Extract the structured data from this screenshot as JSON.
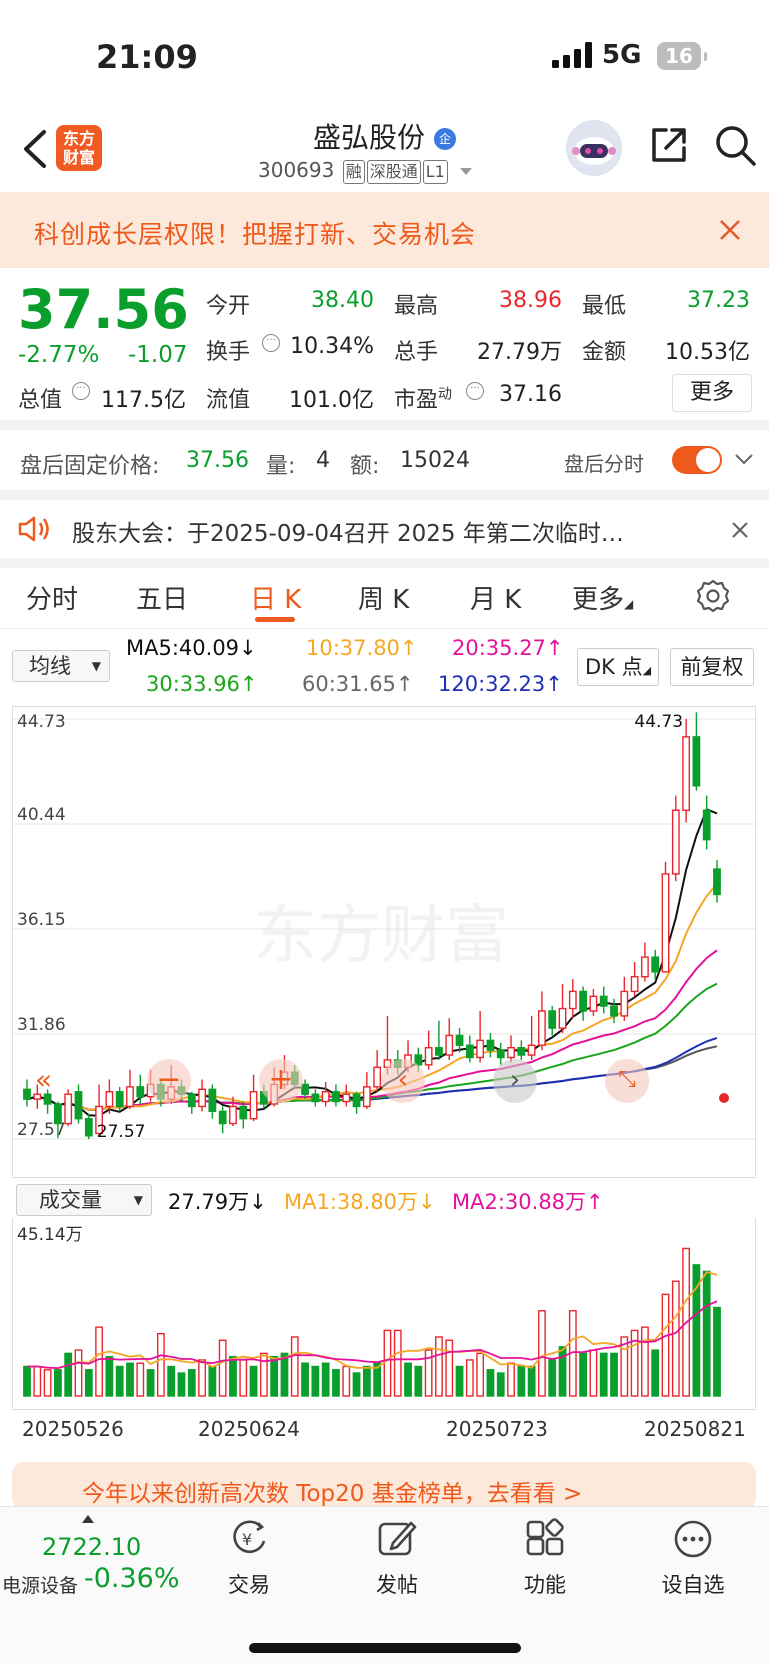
{
  "status_bar": {
    "time": "21:09",
    "network": "5G",
    "battery": "16"
  },
  "header": {
    "logo_line1": "东方",
    "logo_line2": "财富",
    "stock_name": "盛弘股份",
    "badge": "企",
    "code": "300693",
    "tags": [
      "融",
      "深股通",
      "L1"
    ]
  },
  "banner": {
    "text": "科创成长层权限！把握打新、交易机会"
  },
  "quote": {
    "price": "37.56",
    "change_pct": "-2.77%",
    "change": "-1.07",
    "open_label": "今开",
    "open": "38.40",
    "high_label": "最高",
    "high": "38.96",
    "low_label": "最低",
    "low": "37.23",
    "turnover_label": "换手",
    "turnover": "10.34%",
    "volume_label": "总手",
    "volume": "27.79万",
    "amount_label": "金额",
    "amount": "10.53亿",
    "mcap_label": "总值",
    "mcap": "117.5亿",
    "float_label": "流值",
    "float": "101.0亿",
    "pe_label": "市盈",
    "pe_sup": "动",
    "pe": "37.16",
    "more_label": "更多"
  },
  "after_hours": {
    "label": "盘后固定价格:",
    "price": "37.56",
    "vol_label": "量:",
    "vol": "4",
    "amt_label": "额:",
    "amt": "15024",
    "toggle_label": "盘后分时"
  },
  "notice": {
    "text": "股东大会：于2025-09-04召开 2025 年第二次临时…"
  },
  "tabs": [
    {
      "label": "分时"
    },
    {
      "label": "五日"
    },
    {
      "label": "日 K"
    },
    {
      "label": "周 K"
    },
    {
      "label": "月 K"
    },
    {
      "label": "更多"
    }
  ],
  "ma_bar": {
    "selector": "均线",
    "ma5": "MA5:40.09↓",
    "ma10": "10:37.80↑",
    "ma20": "20:35.27↑",
    "ma30": "30:33.96↑",
    "ma60": "60:31.65↑",
    "ma120": "120:32.23↑",
    "dk_label": "DK 点",
    "adjust_label": "前复权"
  },
  "chart_data": {
    "type": "candlestick",
    "y_ticks": [
      "44.73",
      "40.44",
      "36.15",
      "31.86",
      "27.57"
    ],
    "ylim": [
      27.57,
      44.73
    ],
    "max_label": "44.73",
    "min_label": "27.57",
    "watermark": "东方财富",
    "x_labels": [
      "20250526",
      "20250624",
      "20250723",
      "20250821"
    ],
    "candles": [
      [
        29.6,
        29.2,
        30.0,
        28.9
      ],
      [
        29.2,
        29.4,
        29.8,
        28.8
      ],
      [
        29.4,
        29.0,
        29.6,
        28.6
      ],
      [
        29.0,
        28.2,
        29.1,
        27.6
      ],
      [
        28.2,
        29.4,
        29.6,
        28.1
      ],
      [
        29.5,
        28.4,
        29.8,
        28.2
      ],
      [
        28.4,
        27.7,
        28.6,
        27.57
      ],
      [
        27.8,
        28.9,
        29.8,
        27.7
      ],
      [
        28.9,
        29.5,
        30.0,
        28.6
      ],
      [
        29.5,
        28.9,
        29.7,
        28.7
      ],
      [
        28.9,
        29.7,
        30.4,
        28.8
      ],
      [
        29.7,
        29.3,
        30.2,
        29.0
      ],
      [
        29.3,
        29.8,
        30.4,
        29.1
      ],
      [
        29.8,
        29.2,
        30.0,
        28.9
      ],
      [
        29.2,
        29.7,
        30.6,
        29.0
      ],
      [
        29.7,
        29.4,
        30.0,
        29.1
      ],
      [
        29.4,
        28.9,
        29.5,
        28.6
      ],
      [
        28.9,
        29.6,
        30.0,
        28.7
      ],
      [
        29.6,
        28.7,
        29.8,
        28.4
      ],
      [
        28.7,
        28.2,
        28.9,
        27.8
      ],
      [
        28.2,
        28.9,
        29.3,
        28.1
      ],
      [
        28.9,
        28.4,
        29.1,
        28.0
      ],
      [
        28.4,
        29.5,
        30.2,
        28.3
      ],
      [
        29.5,
        29.0,
        29.8,
        28.8
      ],
      [
        29.0,
        29.8,
        30.5,
        28.9
      ],
      [
        29.8,
        30.3,
        31.0,
        29.6
      ],
      [
        30.3,
        29.8,
        30.6,
        29.6
      ],
      [
        29.8,
        29.4,
        30.0,
        29.2
      ],
      [
        29.4,
        29.1,
        29.6,
        28.9
      ],
      [
        29.1,
        29.5,
        29.9,
        28.9
      ],
      [
        29.5,
        29.1,
        29.8,
        28.9
      ],
      [
        29.1,
        29.4,
        29.8,
        28.9
      ],
      [
        29.4,
        28.9,
        29.5,
        28.6
      ],
      [
        28.9,
        29.7,
        30.3,
        28.8
      ],
      [
        29.7,
        30.5,
        31.2,
        29.5
      ],
      [
        30.5,
        30.8,
        32.6,
        30.2
      ],
      [
        30.8,
        30.5,
        31.2,
        30.2
      ],
      [
        30.5,
        31.0,
        31.6,
        30.3
      ],
      [
        31.0,
        30.6,
        31.3,
        30.3
      ],
      [
        30.6,
        31.3,
        32.0,
        30.4
      ],
      [
        31.3,
        31.0,
        32.4,
        30.8
      ],
      [
        31.0,
        31.8,
        32.5,
        30.8
      ],
      [
        31.8,
        31.4,
        32.1,
        31.1
      ],
      [
        31.4,
        30.9,
        31.8,
        30.7
      ],
      [
        30.9,
        31.6,
        32.8,
        30.7
      ],
      [
        31.6,
        31.2,
        31.9,
        30.9
      ],
      [
        31.2,
        30.9,
        31.5,
        30.6
      ],
      [
        30.9,
        31.3,
        31.8,
        30.7
      ],
      [
        31.3,
        31.0,
        31.6,
        30.8
      ],
      [
        31.0,
        31.4,
        32.6,
        30.8
      ],
      [
        31.4,
        32.8,
        33.6,
        31.2
      ],
      [
        32.8,
        32.1,
        33.0,
        31.8
      ],
      [
        32.1,
        32.9,
        33.9,
        31.9
      ],
      [
        32.9,
        33.6,
        34.1,
        32.5
      ],
      [
        33.6,
        32.8,
        33.8,
        32.4
      ],
      [
        32.8,
        33.4,
        33.7,
        32.6
      ],
      [
        33.4,
        33.0,
        33.8,
        32.7
      ],
      [
        33.0,
        32.6,
        33.3,
        32.3
      ],
      [
        32.6,
        33.6,
        34.2,
        32.4
      ],
      [
        33.6,
        34.2,
        34.8,
        33.4
      ],
      [
        34.2,
        35.0,
        35.6,
        34.0
      ],
      [
        35.0,
        34.4,
        35.3,
        34.1
      ],
      [
        34.4,
        38.4,
        38.9,
        34.4
      ],
      [
        38.4,
        41.0,
        41.6,
        38.1
      ],
      [
        41.0,
        44.0,
        44.73,
        40.5
      ],
      [
        44.0,
        42.0,
        45.0,
        41.8
      ],
      [
        41.0,
        39.8,
        41.6,
        39.4
      ],
      [
        38.6,
        37.56,
        38.96,
        37.23
      ]
    ],
    "volume": {
      "label": "成交量",
      "value": "27.79万↓",
      "ma1": "MA1:38.80万↓",
      "ma2": "MA2:30.88万↑",
      "max_label": "45.14万",
      "values": [
        9,
        9,
        8,
        8,
        13,
        14,
        8,
        21,
        12,
        9,
        10,
        10,
        8,
        19,
        9,
        7,
        8,
        11,
        9,
        17,
        12,
        11,
        9,
        13,
        12,
        13,
        18,
        10,
        9,
        10,
        8,
        9,
        7,
        9,
        10,
        20,
        20,
        10,
        9,
        14,
        18,
        17,
        9,
        11,
        13,
        8,
        7,
        10,
        9,
        9,
        26,
        11,
        15,
        26,
        13,
        14,
        13,
        13,
        18,
        20,
        21,
        14,
        31,
        35,
        45,
        40,
        38,
        27
      ],
      "direction": [
        0,
        1,
        1,
        0,
        0,
        1,
        0,
        1,
        0,
        0,
        0,
        1,
        0,
        1,
        0,
        0,
        0,
        1,
        0,
        1,
        0,
        1,
        0,
        1,
        0,
        0,
        1,
        0,
        0,
        0,
        0,
        1,
        0,
        0,
        0,
        1,
        1,
        0,
        0,
        1,
        1,
        1,
        0,
        1,
        1,
        0,
        0,
        1,
        0,
        0,
        1,
        0,
        0,
        1,
        0,
        1,
        0,
        0,
        1,
        1,
        1,
        0,
        1,
        1,
        1,
        0,
        0,
        0
      ]
    }
  },
  "notice_ad": {
    "text": "今年以来创新高次数 Top20 基金榜单，去看看 >"
  },
  "bottom_bar": {
    "index_value": "2722.10",
    "index_name": "电源设备",
    "index_pct": "-0.36%",
    "items": [
      {
        "label": "交易"
      },
      {
        "label": "发帖"
      },
      {
        "label": "功能"
      },
      {
        "label": "设自选"
      }
    ]
  },
  "colors": {
    "up": "#e8262b",
    "down": "#0a9e2c",
    "accent": "#ee5a1c"
  }
}
